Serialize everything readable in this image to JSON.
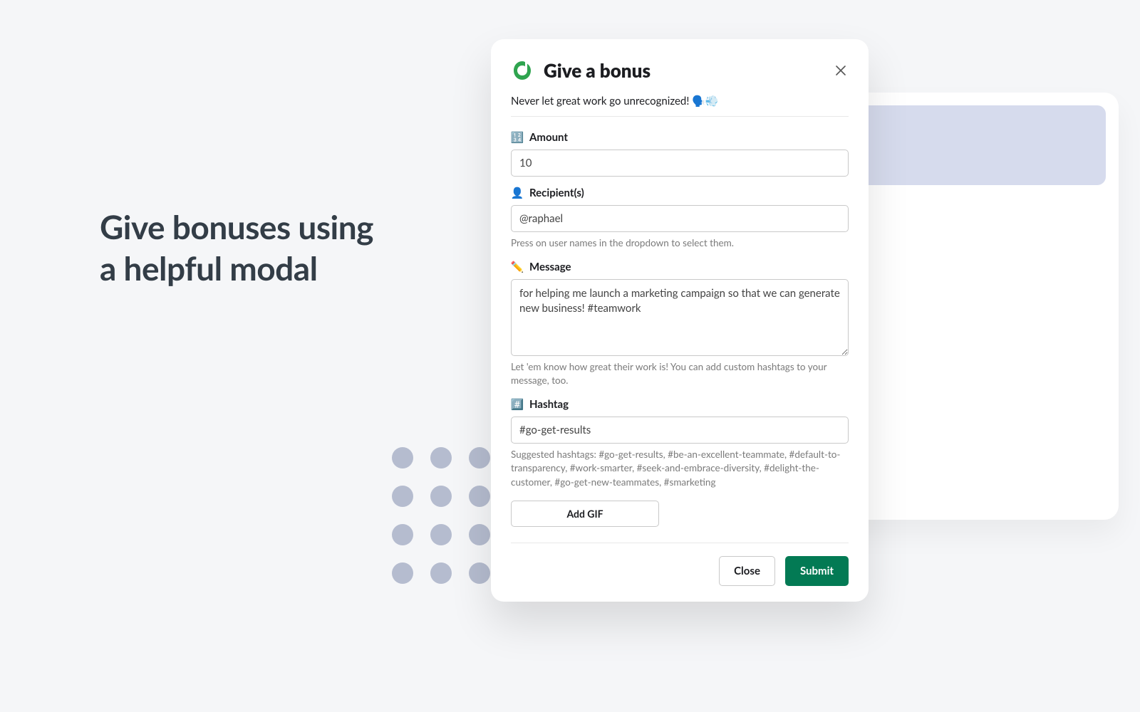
{
  "headline": {
    "line1": "Give bonuses using",
    "line2": "a helpful modal"
  },
  "modal": {
    "title": "Give a bonus",
    "subtitle": "Never let great work go unrecognized! 🗣️💨",
    "amount": {
      "icon": "🔢",
      "label": "Amount",
      "value": "10"
    },
    "recipients": {
      "icon": "👤",
      "label": "Recipient(s)",
      "value": "@raphael",
      "helper": "Press on user names in the dropdown to select them."
    },
    "message": {
      "icon": "✏️",
      "label": "Message",
      "value": "for helping me launch a marketing campaign so that we can generate new business! #teamwork",
      "helper": "Let 'em know how great their work is! You can add custom hashtags to your message, too."
    },
    "hashtag": {
      "icon": "#️⃣",
      "label": "Hashtag",
      "value": "#go-get-results",
      "helper": "Suggested hashtags: #go-get-results, #be-an-excellent-teammate, #default-to-transparency, #work-smarter, #seek-and-embrace-diversity, #delight-the-customer, #go-get-new-teammates, #smarketing"
    },
    "add_gif_label": "Add GIF",
    "close_label": "Close",
    "submit_label": "Submit"
  },
  "colors": {
    "accent_green": "#2fa44f",
    "submit_green": "#037a54",
    "dot": "#b5bccf",
    "bg_strip": "#d6dbed"
  }
}
